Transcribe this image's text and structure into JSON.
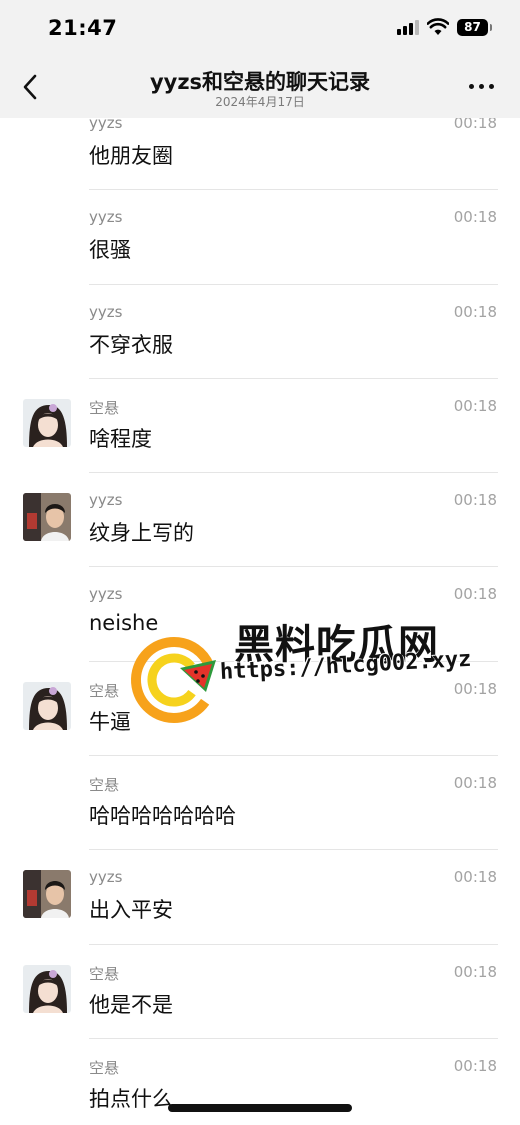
{
  "status_bar": {
    "time": "21:47",
    "battery": "87"
  },
  "header": {
    "title": "yyzs和空悬的聊天记录",
    "subtitle": "2024年4月17日"
  },
  "messages": [
    {
      "sender": "yyzs",
      "time": "00:18",
      "text": "他朋友圈",
      "avatar": "none"
    },
    {
      "sender": "yyzs",
      "time": "00:18",
      "text": "很骚",
      "avatar": "none"
    },
    {
      "sender": "yyzs",
      "time": "00:18",
      "text": "不穿衣服",
      "avatar": "none"
    },
    {
      "sender": "空悬",
      "time": "00:18",
      "text": "啥程度",
      "avatar": "girl"
    },
    {
      "sender": "yyzs",
      "time": "00:18",
      "text": "纹身上写的",
      "avatar": "boy"
    },
    {
      "sender": "yyzs",
      "time": "00:18",
      "text": "neishe",
      "avatar": "none"
    },
    {
      "sender": "空悬",
      "time": "00:18",
      "text": "牛逼",
      "avatar": "girl"
    },
    {
      "sender": "空悬",
      "time": "00:18",
      "text": "哈哈哈哈哈哈哈",
      "avatar": "none"
    },
    {
      "sender": "yyzs",
      "time": "00:18",
      "text": "出入平安",
      "avatar": "boy"
    },
    {
      "sender": "空悬",
      "time": "00:18",
      "text": "他是不是",
      "avatar": "girl"
    },
    {
      "sender": "空悬",
      "time": "00:18",
      "text": "拍点什么",
      "avatar": "none"
    }
  ],
  "watermark": {
    "title": "黑料吃瓜网",
    "url": "https://hlcg002.xyz"
  },
  "colors": {
    "header_bg": "#f2f2f2",
    "divider": "#e5e5e5",
    "logo_orange": "#f7a21b",
    "logo_yellow": "#f6d21d",
    "melon_red": "#e5332a",
    "melon_green": "#2e9a3c"
  }
}
